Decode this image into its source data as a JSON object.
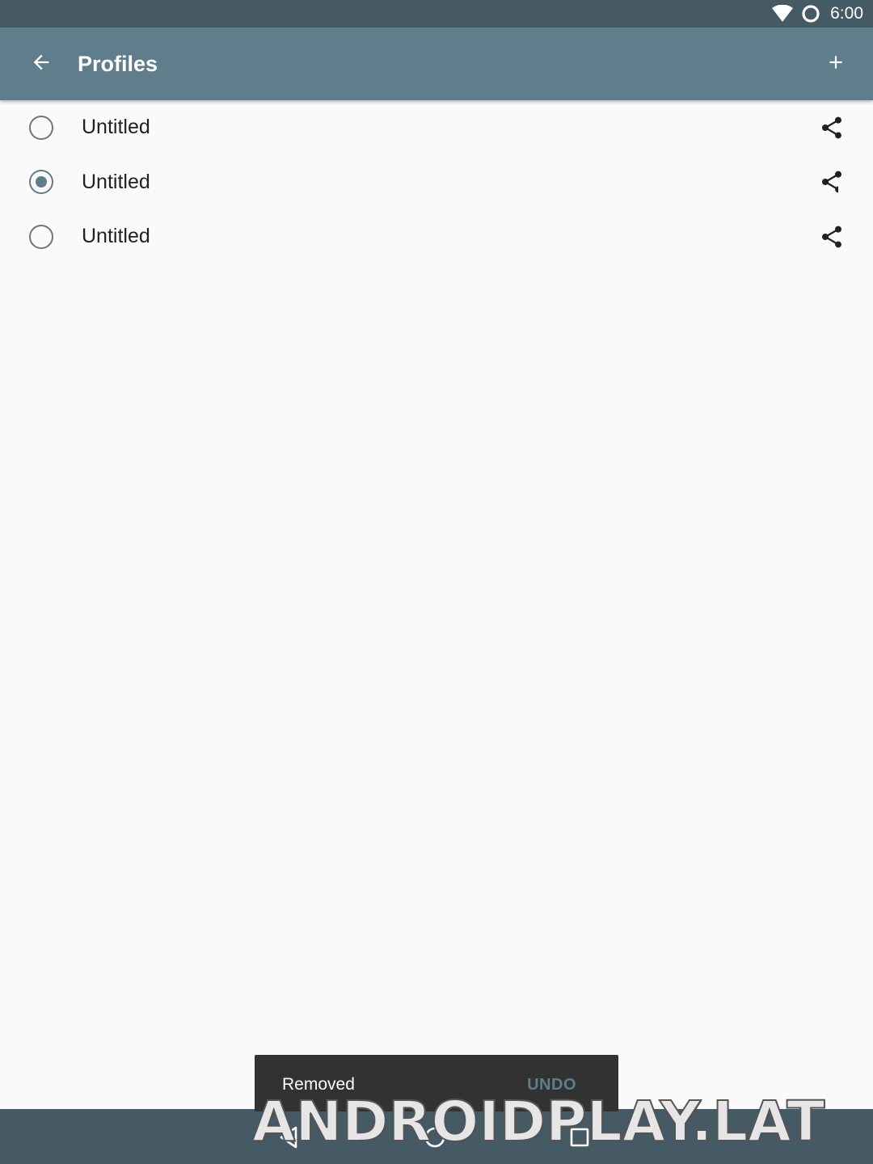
{
  "status_bar": {
    "time": "6:00",
    "icons": [
      "wifi-icon",
      "sync-circle-icon"
    ]
  },
  "toolbar": {
    "title": "Profiles",
    "back_icon": "arrow-back-icon",
    "add_icon": "plus-icon"
  },
  "profiles": [
    {
      "label": "Untitled",
      "selected": false
    },
    {
      "label": "Untitled",
      "selected": true
    },
    {
      "label": "Untitled",
      "selected": false
    }
  ],
  "snackbar": {
    "message": "Removed",
    "action": "UNDO"
  },
  "nav_bar": {
    "icons": [
      "nav-back-icon",
      "nav-home-icon",
      "nav-recents-icon"
    ]
  },
  "watermark": {
    "text": "ANDROIDPLAY.LAT"
  },
  "colors": {
    "primary": "#607d8b",
    "primary_dark": "#455a64",
    "background": "#fafafa",
    "snackbar_bg": "#323232"
  }
}
